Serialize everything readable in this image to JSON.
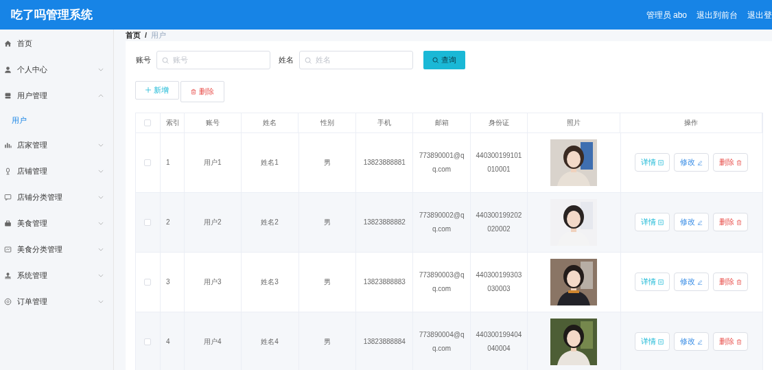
{
  "header": {
    "title": "吃了吗管理系统",
    "links": [
      "管理员 abo",
      "退出到前台",
      "退出登"
    ]
  },
  "sidebar": {
    "items": [
      {
        "label": "首页",
        "kind": "link"
      },
      {
        "label": "个人中心",
        "kind": "menu",
        "expanded": false
      },
      {
        "label": "用户管理",
        "kind": "menu",
        "expanded": true,
        "children": [
          {
            "label": "用户",
            "selected": true
          }
        ]
      },
      {
        "label": "店家管理",
        "kind": "menu",
        "expanded": false
      },
      {
        "label": "店铺管理",
        "kind": "menu",
        "expanded": false
      },
      {
        "label": "店铺分类管理",
        "kind": "menu",
        "expanded": false
      },
      {
        "label": "美食管理",
        "kind": "menu",
        "expanded": false
      },
      {
        "label": "美食分类管理",
        "kind": "menu",
        "expanded": false
      },
      {
        "label": "系统管理",
        "kind": "menu",
        "expanded": false
      },
      {
        "label": "订单管理",
        "kind": "menu",
        "expanded": false
      }
    ]
  },
  "breadcrumb": {
    "items": [
      "首页",
      "用户"
    ],
    "separator": "/"
  },
  "search": {
    "fields": [
      {
        "label": "账号",
        "placeholder": "账号"
      },
      {
        "label": "姓名",
        "placeholder": "姓名"
      }
    ],
    "button": "查询"
  },
  "actions": [
    {
      "label": "新增",
      "kind": "add"
    },
    {
      "label": "删除",
      "kind": "delete"
    }
  ],
  "table": {
    "all_selected": false,
    "columns": [
      "索引",
      "账号",
      "姓名",
      "性别",
      "手机",
      "邮箱",
      "身份证",
      "照片",
      "操作"
    ],
    "rows": [
      {
        "checked": false,
        "index": "1",
        "account": "用户1",
        "name": "姓名1",
        "gender": "男",
        "phone": "13823888881",
        "email": "773890001@qq.com",
        "id_card": "440300199101010001",
        "photo": {
          "kind": "picture"
        },
        "buttons": [
          "详情",
          "修改",
          "删除"
        ]
      },
      {
        "checked": false,
        "index": "2",
        "account": "用户2",
        "name": "姓名2",
        "gender": "男",
        "phone": "13823888882",
        "email": "773890002@qq.com",
        "id_card": "440300199202020002",
        "photo": {
          "kind": "picture"
        },
        "buttons": [
          "详情",
          "修改",
          "删除"
        ]
      },
      {
        "checked": false,
        "index": "3",
        "account": "用户3",
        "name": "姓名3",
        "gender": "男",
        "phone": "13823888883",
        "email": "773890003@qq.com",
        "id_card": "440300199303030003",
        "photo": {
          "kind": "picture"
        },
        "buttons": [
          "详情",
          "修改",
          "删除"
        ]
      },
      {
        "checked": false,
        "index": "4",
        "account": "用户4",
        "name": "姓名4",
        "gender": "男",
        "phone": "13823888884",
        "email": "773890004@qq.com",
        "id_card": "440300199404040004",
        "photo": {
          "kind": "picture"
        },
        "buttons": [
          "详情",
          "修改",
          "删除"
        ]
      }
    ]
  }
}
